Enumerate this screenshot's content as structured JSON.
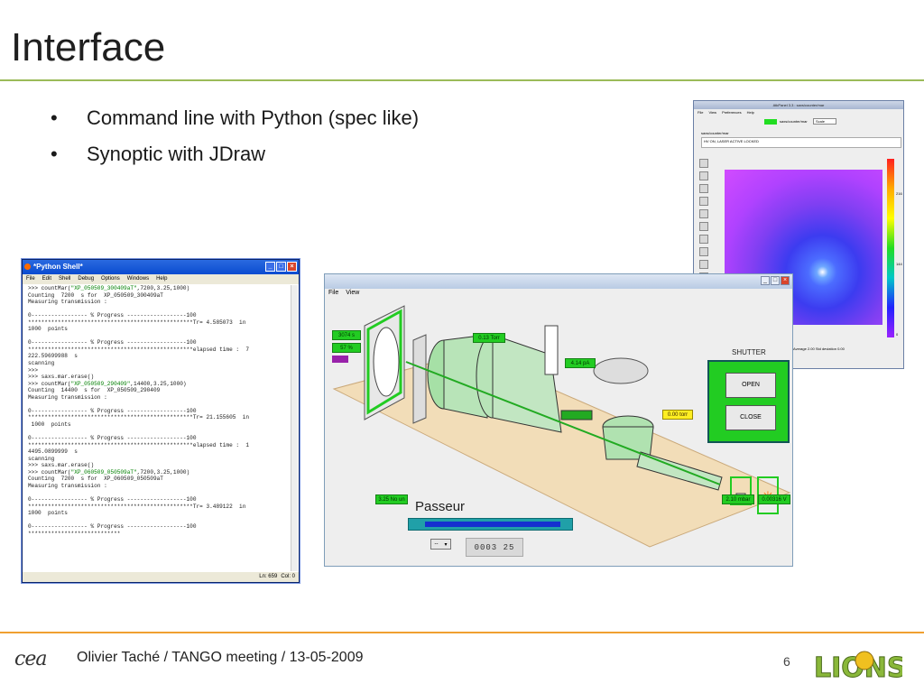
{
  "slide": {
    "title": "Interface",
    "bullets": [
      "Command line with Python (spec like)",
      "Synoptic with JDraw"
    ]
  },
  "python_shell": {
    "title": "*Python Shell*",
    "menu": [
      "File",
      "Edit",
      "Shell",
      "Debug",
      "Options",
      "Windows",
      "Help"
    ],
    "lines": [
      ">>> countMar(\"XP_050509_300409aT\",7200,3.25,1000)",
      "Counting  7200  s for  XP_050509_300409aT",
      "Measuring transmission :",
      "",
      "0----------------- % Progress ------------------100",
      "**************************************************Tr= 4.585073  in",
      "1000  points",
      "",
      "0----------------- % Progress ------------------100",
      "**************************************************elapsed time :  7",
      "222.59699988  s",
      "scanning",
      ">>>",
      ">>> saxs.mar.erase()",
      ">>> countMar(\"XP_050509_290409\",14400,3.25,1000)",
      "Counting  14400  s for  XP_050509_290409",
      "Measuring transmission :",
      "",
      "0----------------- % Progress ------------------100",
      "**************************************************Tr= 21.155605  in",
      " 1000  points",
      "",
      "0----------------- % Progress ------------------100",
      "**************************************************elapsed time :  1",
      "4495.0899999  s",
      "scanning",
      ">>> saxs.mar.erase()",
      ">>> countMar(\"XP_060509_050509aT\",7200,3.25,1000)",
      "Counting  7200  s for  XP_060509_050509aT",
      "Measuring transmission :",
      "",
      "0----------------- % Progress ------------------100",
      "**************************************************Tr= 3.489122  in",
      "1000  points",
      "",
      "0----------------- % Progress ------------------100",
      "****************************"
    ],
    "status_line": "Ln: 659",
    "status_col": "Col: 0"
  },
  "atk_panel": {
    "title": "AtkPanel  3.3  :  saxs/counter/mar",
    "menu": [
      "File",
      "View",
      "Preferences",
      "Help"
    ],
    "device_label": "saxs/counter/mar",
    "selector": "Scale",
    "state_label": "saxs/counter/mar",
    "state_text": "HV ON, LASER ACTIVE LOCKED",
    "footer": "Average 2.00  Std deviation 0.00",
    "ticks": [
      "216",
      "144",
      "0"
    ]
  },
  "jdraw": {
    "menu": [
      "File",
      "View"
    ],
    "values": {
      "time": "3074 s",
      "percent": "57 %",
      "pressure": "0.13 Torr",
      "current": "4.14 pA",
      "pressure2": "0.00 torr",
      "sample_pos": "3.25 No un",
      "distance": "2.10 mbar",
      "volt": "0.00316 V"
    },
    "shutter": {
      "label": "SHUTTER",
      "open": "OPEN",
      "close": "CLOSE"
    },
    "passeur": {
      "title": "Passeur",
      "combo": "--",
      "digits": "0003 25"
    }
  },
  "footer": {
    "cea": "cea",
    "text": "Olivier Taché   /  TANGO meeting  / 13-05-2009",
    "page": "6",
    "logo": "LIONS"
  }
}
